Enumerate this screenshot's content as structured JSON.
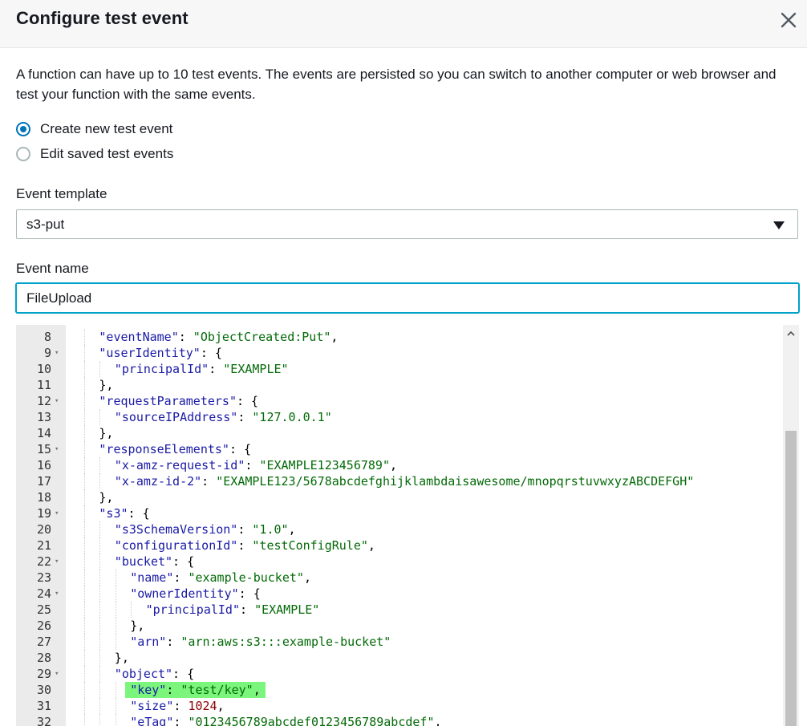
{
  "dialog": {
    "title": "Configure test event",
    "description": "A function can have up to 10 test events. The events are persisted so you can switch to another computer or web browser and test your function with the same events."
  },
  "options": [
    {
      "label": "Create new test event",
      "checked": true
    },
    {
      "label": "Edit saved test events",
      "checked": false
    }
  ],
  "event_template": {
    "label": "Event template",
    "value": "s3-put"
  },
  "event_name": {
    "label": "Event name",
    "value": "FileUpload"
  },
  "editor": {
    "lines": [
      {
        "n": "8",
        "fold": false,
        "indent": 2,
        "tokens": [
          [
            "key",
            "\"eventName\""
          ],
          [
            "punc",
            ": "
          ],
          [
            "str",
            "\"ObjectCreated:Put\""
          ],
          [
            "punc",
            ","
          ]
        ]
      },
      {
        "n": "9",
        "fold": true,
        "indent": 2,
        "tokens": [
          [
            "key",
            "\"userIdentity\""
          ],
          [
            "punc",
            ": {"
          ]
        ]
      },
      {
        "n": "10",
        "fold": false,
        "indent": 3,
        "tokens": [
          [
            "key",
            "\"principalId\""
          ],
          [
            "punc",
            ": "
          ],
          [
            "str",
            "\"EXAMPLE\""
          ]
        ]
      },
      {
        "n": "11",
        "fold": false,
        "indent": 2,
        "tokens": [
          [
            "punc",
            "},"
          ]
        ]
      },
      {
        "n": "12",
        "fold": true,
        "indent": 2,
        "tokens": [
          [
            "key",
            "\"requestParameters\""
          ],
          [
            "punc",
            ": {"
          ]
        ]
      },
      {
        "n": "13",
        "fold": false,
        "indent": 3,
        "tokens": [
          [
            "key",
            "\"sourceIPAddress\""
          ],
          [
            "punc",
            ": "
          ],
          [
            "str",
            "\"127.0.0.1\""
          ]
        ]
      },
      {
        "n": "14",
        "fold": false,
        "indent": 2,
        "tokens": [
          [
            "punc",
            "},"
          ]
        ]
      },
      {
        "n": "15",
        "fold": true,
        "indent": 2,
        "tokens": [
          [
            "key",
            "\"responseElements\""
          ],
          [
            "punc",
            ": {"
          ]
        ]
      },
      {
        "n": "16",
        "fold": false,
        "indent": 3,
        "tokens": [
          [
            "key",
            "\"x-amz-request-id\""
          ],
          [
            "punc",
            ": "
          ],
          [
            "str",
            "\"EXAMPLE123456789\""
          ],
          [
            "punc",
            ","
          ]
        ]
      },
      {
        "n": "17",
        "fold": false,
        "indent": 3,
        "tokens": [
          [
            "key",
            "\"x-amz-id-2\""
          ],
          [
            "punc",
            ": "
          ],
          [
            "str",
            "\"EXAMPLE123/5678abcdefghijklambdaisawesome/mnopqrstuvwxyzABCDEFGH\""
          ]
        ]
      },
      {
        "n": "18",
        "fold": false,
        "indent": 2,
        "tokens": [
          [
            "punc",
            "},"
          ]
        ]
      },
      {
        "n": "19",
        "fold": true,
        "indent": 2,
        "tokens": [
          [
            "key",
            "\"s3\""
          ],
          [
            "punc",
            ": {"
          ]
        ]
      },
      {
        "n": "20",
        "fold": false,
        "indent": 3,
        "tokens": [
          [
            "key",
            "\"s3SchemaVersion\""
          ],
          [
            "punc",
            ": "
          ],
          [
            "str",
            "\"1.0\""
          ],
          [
            "punc",
            ","
          ]
        ]
      },
      {
        "n": "21",
        "fold": false,
        "indent": 3,
        "tokens": [
          [
            "key",
            "\"configurationId\""
          ],
          [
            "punc",
            ": "
          ],
          [
            "str",
            "\"testConfigRule\""
          ],
          [
            "punc",
            ","
          ]
        ]
      },
      {
        "n": "22",
        "fold": true,
        "indent": 3,
        "tokens": [
          [
            "key",
            "\"bucket\""
          ],
          [
            "punc",
            ": {"
          ]
        ]
      },
      {
        "n": "23",
        "fold": false,
        "indent": 4,
        "tokens": [
          [
            "key",
            "\"name\""
          ],
          [
            "punc",
            ": "
          ],
          [
            "str",
            "\"example-bucket\""
          ],
          [
            "punc",
            ","
          ]
        ]
      },
      {
        "n": "24",
        "fold": true,
        "indent": 4,
        "tokens": [
          [
            "key",
            "\"ownerIdentity\""
          ],
          [
            "punc",
            ": {"
          ]
        ]
      },
      {
        "n": "25",
        "fold": false,
        "indent": 5,
        "tokens": [
          [
            "key",
            "\"principalId\""
          ],
          [
            "punc",
            ": "
          ],
          [
            "str",
            "\"EXAMPLE\""
          ]
        ]
      },
      {
        "n": "26",
        "fold": false,
        "indent": 4,
        "tokens": [
          [
            "punc",
            "},"
          ]
        ]
      },
      {
        "n": "27",
        "fold": false,
        "indent": 4,
        "tokens": [
          [
            "key",
            "\"arn\""
          ],
          [
            "punc",
            ": "
          ],
          [
            "str",
            "\"arn:aws:s3:::example-bucket\""
          ]
        ]
      },
      {
        "n": "28",
        "fold": false,
        "indent": 3,
        "tokens": [
          [
            "punc",
            "},"
          ]
        ]
      },
      {
        "n": "29",
        "fold": true,
        "indent": 3,
        "tokens": [
          [
            "key",
            "\"object\""
          ],
          [
            "punc",
            ": {"
          ]
        ]
      },
      {
        "n": "30",
        "fold": false,
        "indent": 4,
        "highlight": true,
        "tokens": [
          [
            "key",
            "\"key\""
          ],
          [
            "punc",
            ": "
          ],
          [
            "str",
            "\"test/key\""
          ],
          [
            "punc",
            ","
          ]
        ]
      },
      {
        "n": "31",
        "fold": false,
        "indent": 4,
        "tokens": [
          [
            "key",
            "\"size\""
          ],
          [
            "punc",
            ": "
          ],
          [
            "num",
            "1024"
          ],
          [
            "punc",
            ","
          ]
        ]
      },
      {
        "n": "32",
        "fold": false,
        "indent": 4,
        "tokens": [
          [
            "key",
            "\"eTag\""
          ],
          [
            "punc",
            ": "
          ],
          [
            "str",
            "\"0123456789abcdef0123456789abcdef\""
          ],
          [
            "punc",
            ","
          ]
        ]
      }
    ]
  }
}
